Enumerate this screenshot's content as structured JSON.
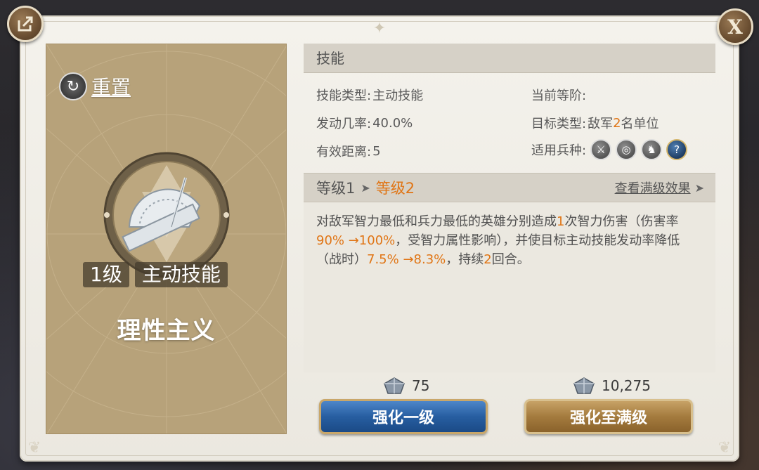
{
  "left_card": {
    "reset_label": "重置",
    "level_tag": "1级",
    "type_tag": "主动技能",
    "skill_name": "理性主义"
  },
  "skill_section": {
    "header": "技能",
    "skill_type_label": "技能类型:",
    "skill_type_value": "主动技能",
    "current_rank_label": "当前等阶:",
    "current_rank_value": "",
    "trigger_rate_label": "发动几率:",
    "trigger_rate_value": "40.0%",
    "target_type_label": "目标类型:",
    "target_type_prefix": "敌军",
    "target_type_count": "2",
    "target_type_suffix": "名单位",
    "range_label": "有效距离:",
    "range_value": "5",
    "troop_type_label": "适用兵种:",
    "troop_icons": [
      "sword-icon",
      "target-icon",
      "horse-icon",
      "question-icon"
    ]
  },
  "level_bar": {
    "current": "等级1",
    "next": "等级2",
    "view_max": "查看满级效果"
  },
  "description": {
    "p1": "对敌军智力最低和兵力最低的英雄分别造成",
    "n1": "1",
    "p2": "次智力伤害（伤害率",
    "n2": "90% →100%",
    "p3": "，受智力属性影响），并使目标主动技能发动率降低（战时）",
    "n3": "7.5% →8.3%",
    "p4": "，持续",
    "n4": "2",
    "p5": "回合。"
  },
  "costs": {
    "upgrade_one_cost": "75",
    "upgrade_max_cost": "10,275"
  },
  "buttons": {
    "upgrade_one": "强化一级",
    "upgrade_max": "强化至满级"
  },
  "colors": {
    "accent_orange": "#e07515",
    "card_tan": "#b7a27a",
    "button_blue": "#275ea1",
    "button_gold": "#a47b3e"
  }
}
